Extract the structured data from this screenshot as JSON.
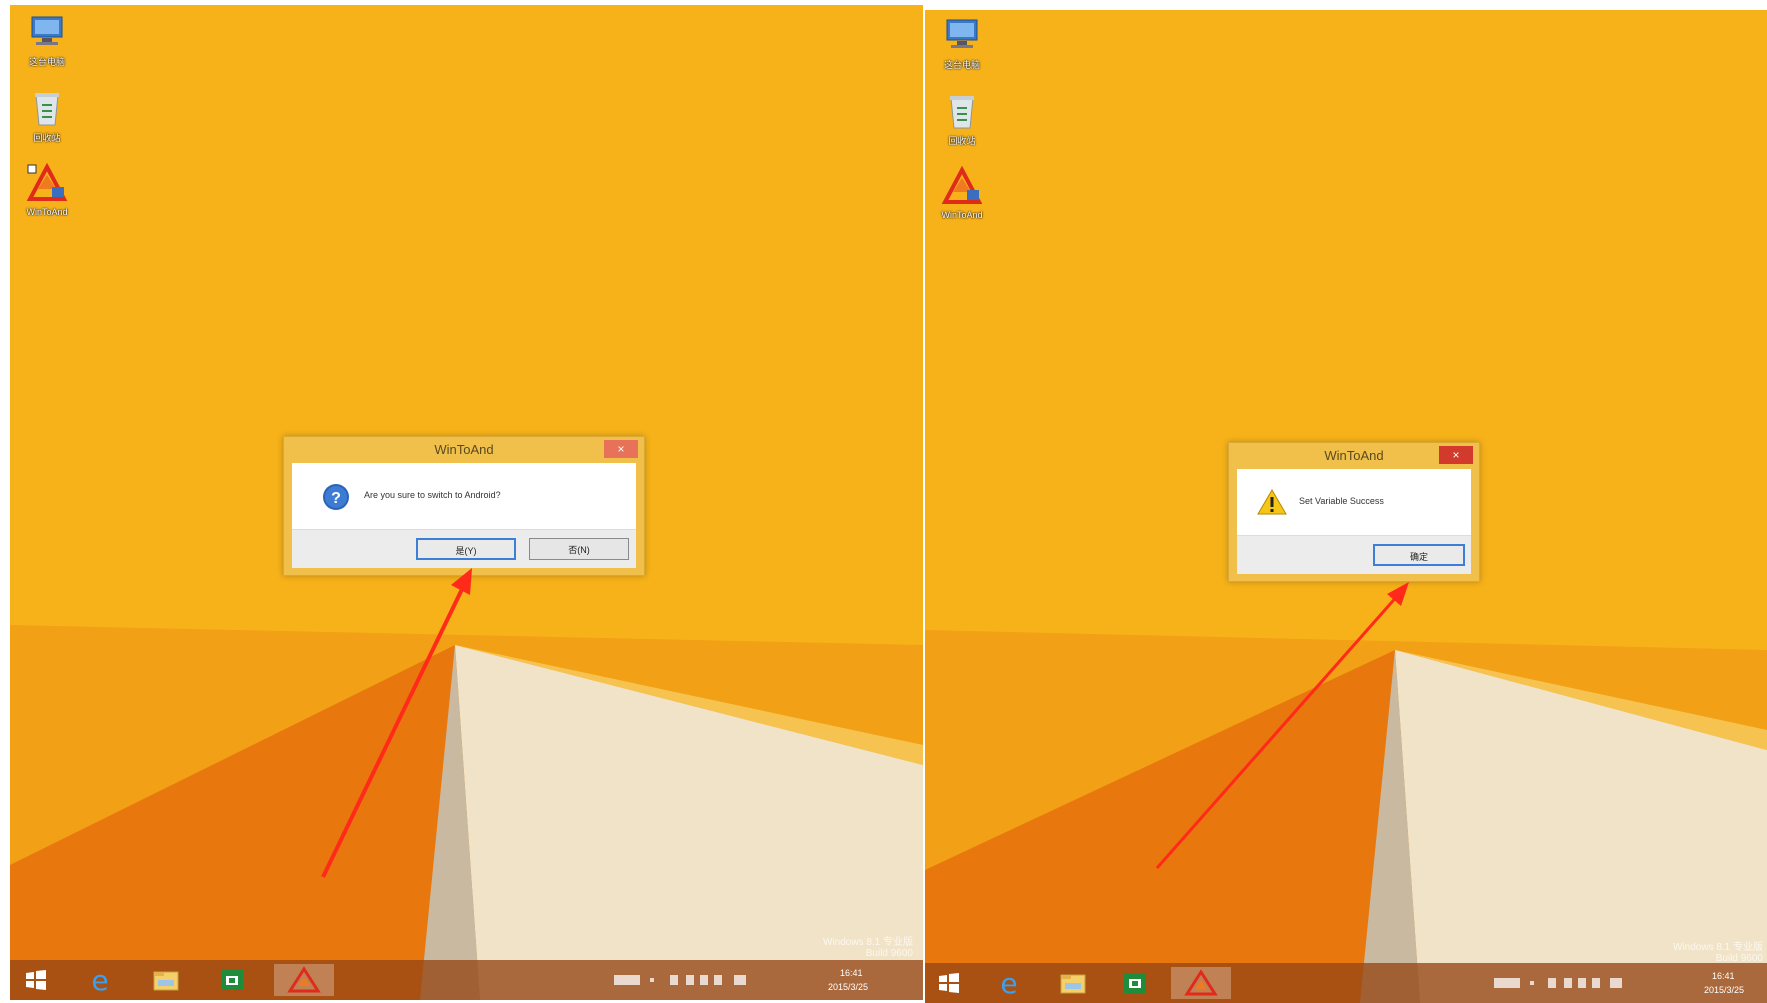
{
  "colors": {
    "wallpaper": "#f7b21a",
    "wallpaper_dark": "#e8780e",
    "beige": "#f1e3c7",
    "arrow": "#ff2a1a",
    "dialog_frame": "#f0c04a"
  },
  "desktop_icons": [
    {
      "label": "这台电脑",
      "icon": "computer-icon"
    },
    {
      "label": "回收站",
      "icon": "recycle-bin-icon"
    },
    {
      "label": "WinToAnd",
      "icon": "wintoand-icon"
    }
  ],
  "left_panel": {
    "dialog": {
      "title": "WinToAnd",
      "close_label": "×",
      "icon": "question-icon",
      "message": "Are you sure to switch to Android?",
      "yes_label": "是(Y)",
      "no_label": "否(N)"
    }
  },
  "right_panel": {
    "dialog": {
      "title": "WinToAnd",
      "close_label": "×",
      "icon": "warning-icon",
      "message": "Set Variable Success",
      "ok_label": "确定"
    }
  },
  "taskbar": {
    "items": [
      "start-icon",
      "internet-explorer-icon",
      "file-explorer-icon",
      "store-icon",
      "wintoand-icon"
    ],
    "time": "16:41",
    "date": "2015/3/25"
  },
  "watermark": {
    "line1": "Windows 8.1 专业版",
    "line2": "Build 9600"
  }
}
